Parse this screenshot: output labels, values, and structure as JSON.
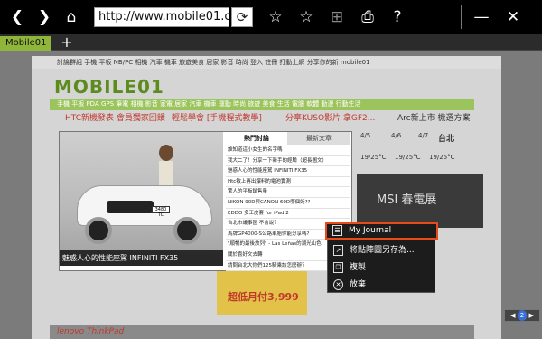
{
  "toolbar": {
    "address": "http://www.mobile01.com/",
    "icons": [
      "back-icon",
      "forward-icon",
      "home-icon",
      "refresh-icon",
      "add-favorite-icon",
      "favorites-icon",
      "crop-icon",
      "print-icon",
      "help-icon",
      "minimize-icon",
      "close-icon"
    ]
  },
  "tabs": {
    "current_label": "Mobile01",
    "new_tab": "+"
  },
  "site": {
    "topnav": "討論群組   手機  平板  NB/PC  相機  汽車  機車  旅遊美食  居家  影音  時尚  登入  註冊        打動上網   分享你的新 mobile01",
    "logo": "MOBILE01",
    "navbar": "手機  平板  PDA  GPS  筆電  相機  影音  家電  居家  汽車  機車  運動  時尚  旅遊  美食  生活  電腦  軟體  動漫  行動生活",
    "promos": [
      "HTC新機發表 會員獨家回饋",
      "輕鬆學會 [手機程式教學]",
      "分享KUSO影片 拿GF2...",
      "Arc新上市 機選方案"
    ],
    "forecast": {
      "city": "台北",
      "dates": [
        "4/5",
        "4/6",
        "4/7"
      ],
      "temps": [
        "19/25°C",
        "19/25°C",
        "19/25°C"
      ]
    },
    "banner_text": "MSI 春電展",
    "ad_price": "超低月付3,999",
    "ad_brand": "lenovo  ThinkPad"
  },
  "overlay": {
    "tabs": [
      "熱門討論",
      "最新文章"
    ],
    "caption": "魅惑人心的性能座駕 INFINITI FX35",
    "plate": "3480 TC",
    "items": [
      "誰知道這小女生的名字嗎",
      "我大二了！分享一下新手的經驗（超長圖文）",
      "魅惑人心的性能座駕 INFINITI FX35",
      "Htc敏上再出爆料的電池實測",
      "驚人的平板銷售量",
      "NIKON 90D與CANON 60D哪個好??",
      "EDDO 多工皮套 for iPad 2",
      "台北市議事區 不會說？",
      "馬牌GP4000-S公路車胎你能分享嗎?",
      "\"順暢的最後放列\" - Las Leñas的湖光山色",
      "關於喜好文去轉",
      "請問台北大你們125騎乘該怎麼辦？"
    ]
  },
  "context_menu": {
    "items": [
      "My Journal",
      "將點陣圖另存為...",
      "複製",
      "放棄"
    ]
  },
  "pager": {
    "page": "2"
  }
}
